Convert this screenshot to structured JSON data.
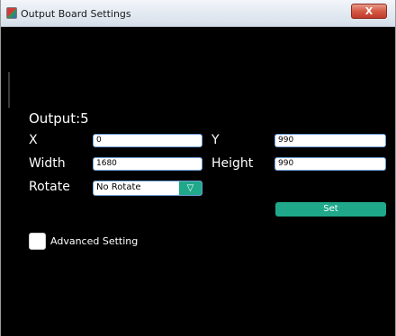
{
  "window": {
    "title": "Output Board Settings",
    "close_label": "X"
  },
  "output": {
    "label": "Output:5"
  },
  "fields": {
    "x": {
      "label": "X",
      "value": "0"
    },
    "y": {
      "label": "Y",
      "value": "990"
    },
    "width": {
      "label": "Width",
      "value": "1680"
    },
    "height": {
      "label": "Height",
      "value": "990"
    }
  },
  "rotate": {
    "label": "Rotate",
    "selected": "No Rotate",
    "arrow_icon": "triangle-down-icon"
  },
  "actions": {
    "set_label": "Set"
  },
  "advanced": {
    "label": "Advanced Setting",
    "checked": false
  },
  "colors": {
    "background": "#000000",
    "accent": "#1fa88a",
    "field_border": "#6f9ed6",
    "close_button": "#c0392b"
  }
}
